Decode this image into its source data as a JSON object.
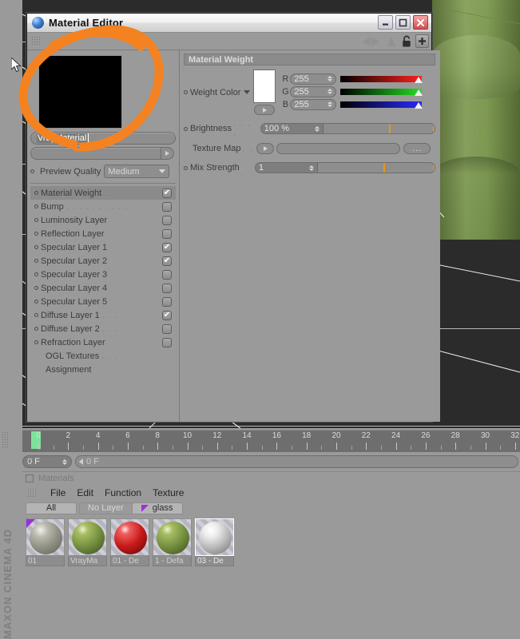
{
  "window": {
    "title": "Material Editor",
    "icon": "sphere-icon",
    "buttons": {
      "minimize": "_",
      "maximize": "□",
      "close": "✕"
    },
    "toolbar": {
      "lock": "lock-icon",
      "add": "+",
      "nav_back": "◀",
      "nav_fwd": "▶"
    }
  },
  "left_panel": {
    "preview_color": "#000000",
    "material_name": "VrayMaterial",
    "path_value": "",
    "preview_quality_label": "Preview Quality",
    "preview_quality_value": "Medium",
    "channels": [
      {
        "label": "Material Weight",
        "dots": "..",
        "checked": true,
        "selected": true
      },
      {
        "label": "Bump",
        "dots": ". . . . . . . . . .",
        "checked": false,
        "selected": false
      },
      {
        "label": "Luminosity Layer",
        "dots": "",
        "checked": false,
        "selected": false
      },
      {
        "label": "Reflection Layer",
        "dots": "",
        "checked": false,
        "selected": false
      },
      {
        "label": "Specular Layer 1",
        "dots": "",
        "checked": true,
        "selected": false
      },
      {
        "label": "Specular Layer 2",
        "dots": "",
        "checked": true,
        "selected": false
      },
      {
        "label": "Specular Layer 3",
        "dots": "",
        "checked": false,
        "selected": false
      },
      {
        "label": "Specular Layer 4",
        "dots": "",
        "checked": false,
        "selected": false
      },
      {
        "label": "Specular Layer 5",
        "dots": "",
        "checked": false,
        "selected": false
      },
      {
        "label": "Diffuse Layer 1",
        "dots": ". . .",
        "checked": true,
        "selected": false
      },
      {
        "label": "Diffuse Layer 2",
        "dots": ". . .",
        "checked": false,
        "selected": false
      },
      {
        "label": "Refraction Layer",
        "dots": "",
        "checked": false,
        "selected": false
      }
    ],
    "plain_items": [
      {
        "label": "OGL Textures",
        "dots": ". . ."
      },
      {
        "label": "Assignment",
        "dots": ""
      }
    ]
  },
  "right_panel": {
    "header": "Material Weight",
    "weight_color": {
      "label": "Weight Color",
      "swatch": "#ffffff",
      "channels": [
        {
          "letter": "R",
          "value": "255",
          "color": "#ff2020"
        },
        {
          "letter": "G",
          "value": "255",
          "color": "#22e022"
        },
        {
          "letter": "B",
          "value": "255",
          "color": "#2a2aff"
        }
      ]
    },
    "brightness": {
      "label": "Brightness",
      "dots": ". . . .",
      "value": "100 %"
    },
    "texture_map": {
      "label": "Texture Map",
      "dots": ". .",
      "value": "",
      "browse": "..."
    },
    "mix_strength": {
      "label": "Mix Strength",
      "dots": ". .",
      "value": "1"
    }
  },
  "timeline": {
    "ticks": [
      "0",
      "2",
      "4",
      "6",
      "8",
      "10",
      "12",
      "14",
      "16",
      "18",
      "20",
      "22",
      "24",
      "26",
      "28",
      "30",
      "32"
    ],
    "current_frame": "0 F",
    "range_label": "0 F",
    "playhead_frame": 0
  },
  "materials_panel": {
    "title": "Materials",
    "menu": [
      "File",
      "Edit",
      "Function",
      "Texture"
    ],
    "layer_tabs": [
      {
        "label": "All",
        "style": "active"
      },
      {
        "label": "No Layer",
        "style": "dim"
      },
      {
        "label": "glass",
        "style": "group",
        "marker_color": "#9b30d9"
      }
    ],
    "materials": [
      {
        "name": "01",
        "type": "glass",
        "selected": false,
        "tagged": true
      },
      {
        "name": "VrayMa",
        "type": "olive",
        "selected": false,
        "tagged": false
      },
      {
        "name": "01 - De",
        "type": "red",
        "selected": false,
        "tagged": false
      },
      {
        "name": "1 - Defa",
        "type": "olive",
        "selected": false,
        "tagged": false
      },
      {
        "name": "03 - De",
        "type": "white",
        "selected": true,
        "tagged": false
      }
    ]
  },
  "brand": {
    "text": "MAXON CINEMA 4D"
  },
  "annotation": {
    "shape": "orange-ellipse-highlight",
    "color": "#f58220"
  },
  "viewport": {
    "object_color": "#7a964c"
  }
}
